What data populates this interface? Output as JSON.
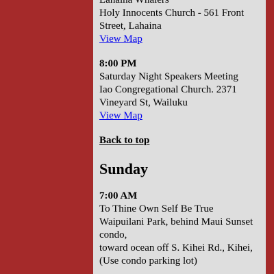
{
  "sections": {
    "prev_meeting": {
      "name": "Lahaina Whalers",
      "location": "Holy Innocents Church - 561 Front Street, Lahaina",
      "map_link": "View Map"
    },
    "meeting_8pm": {
      "time": "8:00 PM",
      "name": "Saturday Night Speakers Meeting",
      "location": "Iao Congregational Church. 2371 Vineyard St, Wailuku",
      "map_link": "View Map"
    },
    "back_to_top": "Back to top",
    "sunday": {
      "day_heading": "Sunday",
      "meeting_7am": {
        "time": "7:00 AM",
        "name": "To Thine Own Self Be True",
        "location_line1": "Waipuilani Park, behind Maui Sunset condo,",
        "location_line2": "toward ocean off S. Kihei Rd., Kihei,",
        "location_line3": "(Use condo parking lot)"
      }
    }
  }
}
